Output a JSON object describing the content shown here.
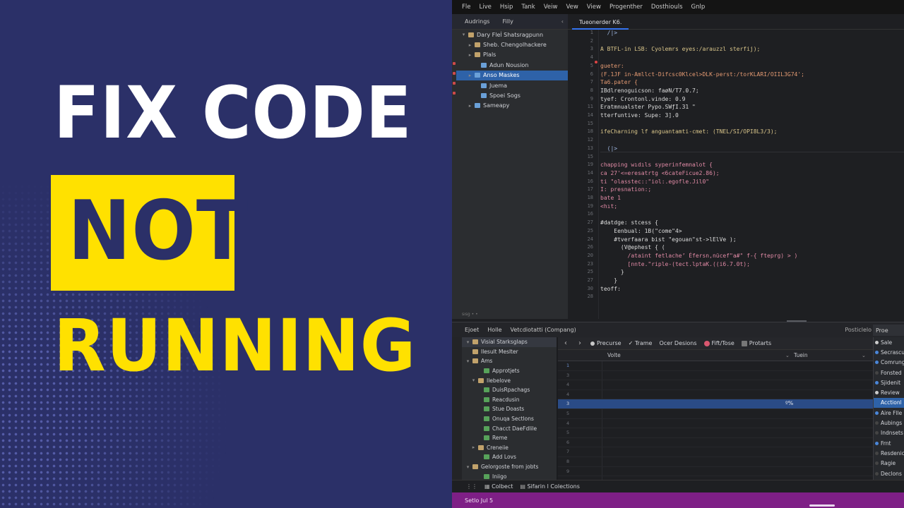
{
  "promo": {
    "line1": "FIX CODE",
    "line2": "NOT",
    "line3": "RUNNING",
    "colors": {
      "background": "#2b3068",
      "highlight": "#ffe100",
      "text": "#ffffff"
    }
  },
  "menu": [
    "Fle",
    "Live",
    "Hsip",
    "Tank",
    "Veiw",
    "Vew",
    "View",
    "Progenther",
    "Dosthiouls",
    "Gnlp"
  ],
  "project_panel": {
    "tabs": [
      "Audrings",
      "Filly"
    ],
    "items": [
      {
        "label": "Dary Flel̇ Shatsragpunn",
        "depth": 0,
        "expanded": true,
        "icon": "folder-icon"
      },
      {
        "label": "Sheb. Chengolhackere",
        "depth": 1,
        "expanded": false,
        "icon": "folder-icon"
      },
      {
        "label": "Plals",
        "depth": 1,
        "expanded": false,
        "icon": "folder-icon"
      },
      {
        "label": "Adun Nousion",
        "depth": 2,
        "expanded": false,
        "icon": "file-icon"
      },
      {
        "label": "Anso Maskes",
        "depth": 1,
        "expanded": false,
        "icon": "file-icon",
        "selected": true
      },
      {
        "label": "Juema",
        "depth": 2,
        "expanded": false,
        "icon": "file-icon"
      },
      {
        "label": "Spoei Sogs",
        "depth": 2,
        "expanded": false,
        "icon": "file-icon"
      },
      {
        "label": "Sameapy",
        "depth": 1,
        "expanded": false,
        "icon": "file-icon"
      }
    ],
    "footer": "sısg • •"
  },
  "editor": {
    "tab": "Tueonerder K6.",
    "lines": [
      {
        "n": "1",
        "text": "  /|>",
        "color": "c-blue"
      },
      {
        "n": "2",
        "text": "",
        "color": "c-white"
      },
      {
        "n": "3",
        "text": "A BTFL-in LSB: Cyolemrs eyes:/arauzzl sterfij);",
        "color": "c-yellow"
      },
      {
        "n": "4",
        "text": "",
        "color": "c-white"
      },
      {
        "n": "5",
        "text": "gueter:",
        "color": "c-orange"
      },
      {
        "n": "6",
        "text": "(F.1JF in-Amllct-Difcsc0Klcel>DLK-perst:/torKLARI/OIIL3G74';",
        "color": "c-orange"
      },
      {
        "n": "7",
        "text": "Ta6.pater {",
        "color": "c-orange"
      },
      {
        "n": "8",
        "text": "IBdlrenoguicson: faøN/T7.0.7;",
        "color": "c-white"
      },
      {
        "n": "9",
        "text": "tyef: Crontonl.vinde: 0.9",
        "color": "c-white"
      },
      {
        "n": "11",
        "text": "Eratmnualster Pypo.SWƒI.31 \"",
        "color": "c-white"
      },
      {
        "n": "14",
        "text": "tterfuntive: Supe: 3].0",
        "color": "c-white"
      },
      {
        "n": "15",
        "text": "",
        "color": "c-white"
      },
      {
        "n": "18",
        "text": "ifeCharning lf anguantamti-cmet: (TNEL/SI/OPI8L3/3);",
        "color": "c-yellow"
      },
      {
        "n": "12",
        "text": "",
        "color": "c-white"
      },
      {
        "n": "13",
        "text": "  (|>",
        "color": "c-blue"
      },
      {
        "n": "15",
        "text": "",
        "color": "c-white"
      },
      {
        "n": "19",
        "text": "chapping wıdıls syperinfemnalot {",
        "color": "c-pink"
      },
      {
        "n": "14",
        "text": "ca 27'<=eresatrtg <6cateFicue2.86);",
        "color": "c-pink"
      },
      {
        "n": "16",
        "text": "ti \"olasstec::\"iol:.egofle.Jil0\"",
        "color": "c-pink"
      },
      {
        "n": "17",
        "text": "I: presnation:;",
        "color": "c-pink"
      },
      {
        "n": "18",
        "text": "bate 1",
        "color": "c-pink"
      },
      {
        "n": "19",
        "text": "<hıt;",
        "color": "c-pink"
      },
      {
        "n": "16",
        "text": "",
        "color": "c-white"
      },
      {
        "n": "27",
        "text": "#datdge: stcess {",
        "color": "c-white"
      },
      {
        "n": "25",
        "text": "    Eenbual: 1B(\"come\"4>",
        "color": "c-white"
      },
      {
        "n": "24",
        "text": "    #tverfaara bist \"egouan\"st->lElVe );",
        "color": "c-white"
      },
      {
        "n": "26",
        "text": "      (V@ephest { (",
        "color": "c-white"
      },
      {
        "n": "20",
        "text": "        /ataint fetlache’ Éfersn,nücef\"a#\" f-{ fteprg) > )",
        "color": "c-pink"
      },
      {
        "n": "23",
        "text": "        [nnte.\"riple-(tect.lptaK.((i6.7.0t);",
        "color": "c-pink"
      },
      {
        "n": "25",
        "text": "      }",
        "color": "c-white"
      },
      {
        "n": "27",
        "text": "    }",
        "color": "c-white"
      },
      {
        "n": "30",
        "text": "teoff:",
        "color": "c-white"
      },
      {
        "n": "28",
        "text": "",
        "color": "c-white"
      }
    ]
  },
  "split_bar": {
    "items": [
      "Ejoet",
      "Holle",
      "Vetcdiotatti (Compang)"
    ],
    "right": "Posticlelo",
    "right2": "Proe"
  },
  "bottom_tree": {
    "items": [
      {
        "label": "Visial Starksglaps",
        "depth": 0,
        "toggle": "▾",
        "header": true
      },
      {
        "label": "Ilesult Meslter",
        "depth": 0,
        "toggle": ""
      },
      {
        "label": "Ams",
        "depth": 0,
        "toggle": "▾"
      },
      {
        "label": "Approtjets",
        "depth": 2,
        "toggle": ""
      },
      {
        "label": "Ilebelove",
        "depth": 1,
        "toggle": "▾"
      },
      {
        "label": "DuisRpachags",
        "depth": 2,
        "toggle": ""
      },
      {
        "label": "Reacdusin",
        "depth": 2,
        "toggle": ""
      },
      {
        "label": "Stue Doasts",
        "depth": 2,
        "toggle": ""
      },
      {
        "label": "Onuqa Sectlons",
        "depth": 2,
        "toggle": ""
      },
      {
        "label": "Chacct DaeFdlile",
        "depth": 2,
        "toggle": ""
      },
      {
        "label": "Reme",
        "depth": 2,
        "toggle": ""
      },
      {
        "label": "Creneiie",
        "depth": 1,
        "toggle": "▸"
      },
      {
        "label": "Add Lovs",
        "depth": 2,
        "toggle": ""
      },
      {
        "label": "Gelorgoste from jobts",
        "depth": 0,
        "toggle": "▾"
      },
      {
        "label": "Iniigo",
        "depth": 2,
        "toggle": ""
      }
    ]
  },
  "grid": {
    "toolbar": [
      "Precurse",
      "Trame",
      "Ocer Desions",
      "Fift/Tose",
      "Protarts"
    ],
    "col1": "Volte",
    "col2": "Tuein",
    "rows": [
      {
        "n": "1",
        "value": "",
        "selected": false,
        "first": true
      },
      {
        "n": "3",
        "value": "",
        "selected": false
      },
      {
        "n": "4",
        "value": "",
        "selected": false
      },
      {
        "n": "4",
        "value": "",
        "selected": false
      },
      {
        "n": "3",
        "value": "º%",
        "selected": true
      },
      {
        "n": "5",
        "value": "",
        "selected": false
      },
      {
        "n": "4",
        "value": "",
        "selected": false
      },
      {
        "n": "5",
        "value": "",
        "selected": false
      },
      {
        "n": "6",
        "value": "",
        "selected": false
      },
      {
        "n": "7",
        "value": "",
        "selected": false
      },
      {
        "n": "8",
        "value": "",
        "selected": false
      },
      {
        "n": "9",
        "value": "",
        "selected": false
      }
    ]
  },
  "right_panel": {
    "items": [
      {
        "label": "Sale",
        "dot": "#cccccc"
      },
      {
        "label": "Secrascul",
        "dot": "#4a86d9"
      },
      {
        "label": "Comrung",
        "dot": "#4a86d9"
      },
      {
        "label": "Fonsted",
        "dot": "#444444"
      },
      {
        "label": "Sjidenit",
        "dot": "#4a86d9"
      },
      {
        "label": "Review",
        "dot": "#cccccc"
      },
      {
        "label": "Acctionl",
        "dot": "#2e62a8",
        "selected": true
      },
      {
        "label": "Aire Flle",
        "dot": "#4a86d9"
      },
      {
        "label": "Aubings",
        "dot": "#444444"
      },
      {
        "label": "Indnsets",
        "dot": "#444444"
      },
      {
        "label": "Frnt",
        "dot": "#4a86d9"
      },
      {
        "label": "Resdenic",
        "dot": "#444444"
      },
      {
        "label": "Ragie",
        "dot": "#444444"
      },
      {
        "label": "Declons",
        "dot": "#444444"
      }
    ]
  },
  "bottom_tabs": [
    "Colbect",
    "Sifarin l Colections"
  ],
  "status": {
    "text": "Setlo Jul 5"
  }
}
